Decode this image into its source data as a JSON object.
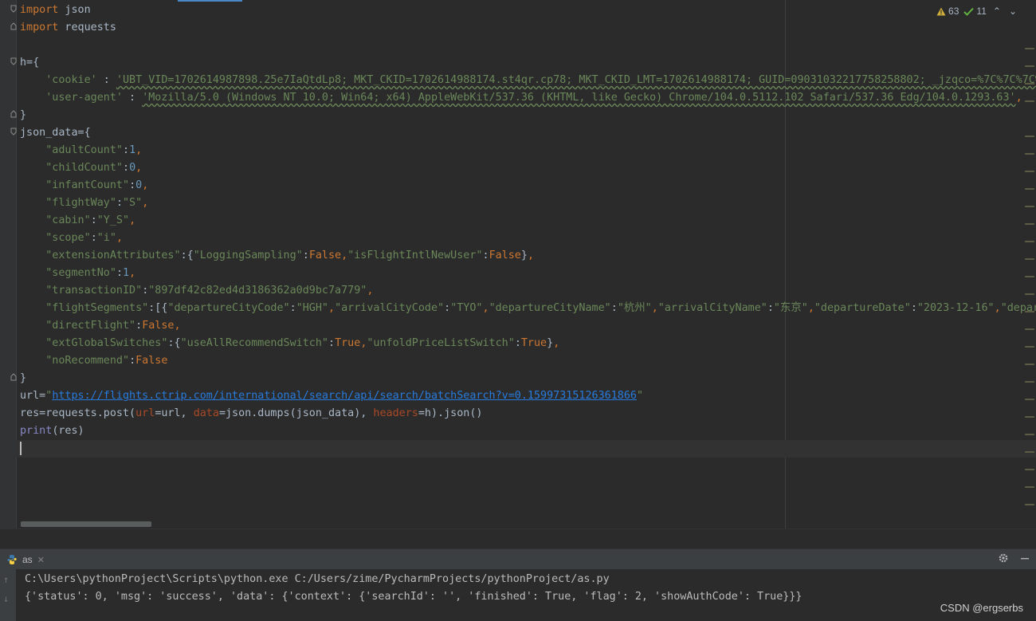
{
  "inspection": {
    "warnings": "63",
    "checks": "11"
  },
  "run_tab": {
    "label": "as"
  },
  "console": {
    "command": "C:\\Users\\pythonProject\\Scripts\\python.exe C:/Users/zime/PycharmProjects/pythonProject/as.py",
    "output": "{'status': 0, 'msg': 'success', 'data': {'context': {'searchId': '', 'finished': True, 'flag': 2, 'showAuthCode': True}}}"
  },
  "watermark": "CSDN @ergserbs",
  "code": {
    "l1_kw": "import",
    "l1_rest": " json",
    "l2_kw": "import",
    "l2_rest": " requests",
    "l4": "h={",
    "l5_key": "'cookie'",
    "l5_colon": " : ",
    "l5_val": "'UBT_VID=1702614987898.25e7IaQtdLp8; MKT_CKID=1702614988174.st4qr.cp78; MKT_CKID_LMT=1702614988174; GUID=09031032217758258802; _jzqco=%7C%7C%7C%7C",
    "l6_key": "'user-agent'",
    "l6_colon": " : ",
    "l6_val": "'Mozilla/5.0 (Windows NT 10.0; Win64; x64) AppleWebKit/537.36 (KHTML, like Gecko) Chrome/104.0.5112.102 Safari/537.36 Edg/104.0.1293.63'",
    "l6_comma": ",",
    "l7": "}",
    "l8": "json_data={",
    "adult_key": "\"adultCount\"",
    "adult_val": "1",
    "child_key": "\"childCount\"",
    "child_val": "0",
    "infant_key": "\"infantCount\"",
    "infant_val": "0",
    "fw_key": "\"flightWay\"",
    "fw_val": "\"S\"",
    "cabin_key": "\"cabin\"",
    "cabin_val": "\"Y_S\"",
    "scope_key": "\"scope\"",
    "scope_val": "\"i\"",
    "ext_key": "\"extensionAttributes\"",
    "ext_k1": "\"LoggingSampling\"",
    "ext_v1": "False",
    "ext_k2": "\"isFlightIntlNewUser\"",
    "ext_v2": "False",
    "seg_key": "\"segmentNo\"",
    "seg_val": "1",
    "tid_key": "\"transactionID\"",
    "tid_val": "\"897df42c82ed4d3186362a0d9bc7a779\"",
    "fs_key": "\"flightSegments\"",
    "fs_k1": "\"departureCityCode\"",
    "fs_v1": "\"HGH\"",
    "fs_k2": "\"arrivalCityCode\"",
    "fs_v2": "\"TYO\"",
    "fs_k3": "\"departureCityName\"",
    "fs_v3": "\"杭州\"",
    "fs_k4": "\"arrivalCityName\"",
    "fs_v4": "\"东京\"",
    "fs_k5": "\"departureDate\"",
    "fs_v5": "\"2023-12-16\"",
    "fs_k6": "\"depart",
    "df_key": "\"directFlight\"",
    "df_val": "False",
    "egs_key": "\"extGlobalSwitches\"",
    "egs_k1": "\"useAllRecommendSwitch\"",
    "egs_v1": "True",
    "egs_k2": "\"unfoldPriceListSwitch\"",
    "egs_v2": "True",
    "nr_key": "\"noRecommend\"",
    "nr_val": "False",
    "l22": "}",
    "url_var": "url=",
    "url_q": "\"",
    "url_link": "https://flights.ctrip.com/international/search/api/search/batchSearch?v=0.15997315126361866",
    "url_q2": "\"",
    "res_a": "res=requests.post(",
    "res_p1": "url",
    "res_b": "=url, ",
    "res_p2": "data",
    "res_c": "=json.dumps(json_data), ",
    "res_p3": "headers",
    "res_d": "=h).json()",
    "print_fn": "print",
    "print_rest": "(res)"
  }
}
